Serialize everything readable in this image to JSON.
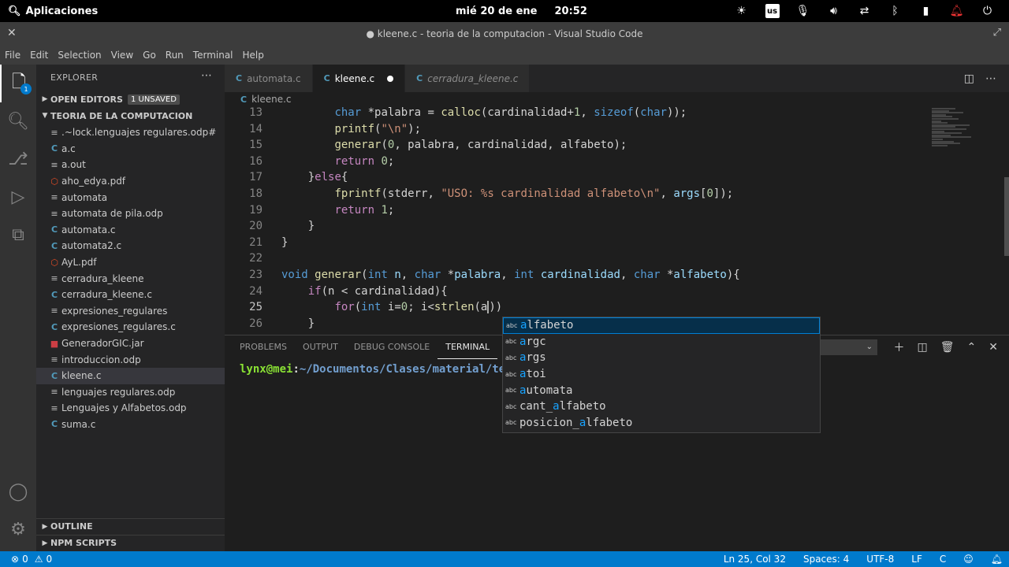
{
  "gnome": {
    "apps_label": "Aplicaciones",
    "date": "mié 20 de ene",
    "time": "20:52",
    "keyboard_layout": "us"
  },
  "window": {
    "title": "● kleene.c - teoria de la computacion - Visual Studio Code"
  },
  "menu": [
    "File",
    "Edit",
    "Selection",
    "View",
    "Go",
    "Run",
    "Terminal",
    "Help"
  ],
  "activity": {
    "explorer_badge": "1"
  },
  "sidebar": {
    "header": "EXPLORER",
    "open_editors": "OPEN EDITORS",
    "unsaved": "1 UNSAVED",
    "folder": "TEORIA DE LA COMPUTACION",
    "files": [
      {
        "name": ".~lock.lenguajes regulares.odp#",
        "type": "plain"
      },
      {
        "name": "a.c",
        "type": "c"
      },
      {
        "name": "a.out",
        "type": "plain"
      },
      {
        "name": "aho_edya.pdf",
        "type": "pdf"
      },
      {
        "name": "automata",
        "type": "plain"
      },
      {
        "name": "automata de pila.odp",
        "type": "plain"
      },
      {
        "name": "automata.c",
        "type": "c"
      },
      {
        "name": "automata2.c",
        "type": "c"
      },
      {
        "name": "AyL.pdf",
        "type": "pdf"
      },
      {
        "name": "cerradura_kleene",
        "type": "plain"
      },
      {
        "name": "cerradura_kleene.c",
        "type": "c"
      },
      {
        "name": "expresiones_regulares",
        "type": "plain"
      },
      {
        "name": "expresiones_regulares.c",
        "type": "c"
      },
      {
        "name": "GeneradorGIC.jar",
        "type": "jar"
      },
      {
        "name": "introduccion.odp",
        "type": "plain"
      },
      {
        "name": "kleene.c",
        "type": "c",
        "selected": true
      },
      {
        "name": "lenguajes regulares.odp",
        "type": "plain"
      },
      {
        "name": "Lenguajes y Alfabetos.odp",
        "type": "plain"
      },
      {
        "name": "suma.c",
        "type": "c"
      }
    ],
    "outline": "OUTLINE",
    "npm": "NPM SCRIPTS"
  },
  "tabs": [
    {
      "label": "automata.c",
      "active": false,
      "italic": false
    },
    {
      "label": "kleene.c",
      "active": true,
      "italic": false,
      "dirty": true
    },
    {
      "label": "cerradura_kleene.c",
      "active": false,
      "italic": true
    }
  ],
  "breadcrumb": "kleene.c",
  "code_lines": [
    {
      "n": "13",
      "html": "        <span class=\"kw\">char</span> *palabra = <span class=\"fn\">calloc</span>(cardinalidad+<span class=\"num\">1</span>, <span class=\"kw\">sizeof</span>(<span class=\"kw\">char</span>));"
    },
    {
      "n": "14",
      "html": "        <span class=\"fn\">printf</span>(<span class=\"str\">\"\\n\"</span>);"
    },
    {
      "n": "15",
      "html": "        <span class=\"fn\">generar</span>(<span class=\"num\">0</span>, palabra, cardinalidad, alfabeto);"
    },
    {
      "n": "16",
      "html": "        <span class=\"ctl\">return</span> <span class=\"num\">0</span>;"
    },
    {
      "n": "17",
      "html": "    }<span class=\"ctl\">else</span>{"
    },
    {
      "n": "18",
      "html": "        <span class=\"fn\">fprintf</span>(stderr, <span class=\"str\">\"USO: %s cardinalidad alfabeto\\n\"</span>, <span class=\"var\">args</span>[<span class=\"num\">0</span>]);"
    },
    {
      "n": "19",
      "html": "        <span class=\"ctl\">return</span> <span class=\"num\">1</span>;"
    },
    {
      "n": "20",
      "html": "    }"
    },
    {
      "n": "21",
      "html": "}"
    },
    {
      "n": "22",
      "html": ""
    },
    {
      "n": "23",
      "html": "<span class=\"kw\">void</span> <span class=\"fn\">generar</span>(<span class=\"kw\">int</span> <span class=\"var\">n</span>, <span class=\"kw\">char</span> *<span class=\"var\">palabra</span>, <span class=\"kw\">int</span> <span class=\"var\">cardinalidad</span>, <span class=\"kw\">char</span> *<span class=\"var\">alfabeto</span>){"
    },
    {
      "n": "24",
      "html": "    <span class=\"ctl\">if</span>(n < cardinalidad){"
    },
    {
      "n": "25",
      "html": "        <span class=\"ctl\">for</span>(<span class=\"kw\">int</span> i=<span class=\"num\">0</span>; i<<span class=\"fn\">strlen</span>(a<span class=\"cursor\"></span>))",
      "current": true
    },
    {
      "n": "26",
      "html": "    }"
    }
  ],
  "panel": {
    "tabs": [
      "PROBLEMS",
      "OUTPUT",
      "DEBUG CONSOLE",
      "TERMINAL"
    ],
    "active": "TERMINAL",
    "terminal_user": "lynx@mei",
    "terminal_colon": ":",
    "terminal_path": "~/Documentos/Clases/material/te"
  },
  "suggest": [
    {
      "pre": "",
      "hl": "a",
      "post": "lfabeto",
      "selected": true
    },
    {
      "pre": "",
      "hl": "a",
      "post": "rgc"
    },
    {
      "pre": "",
      "hl": "a",
      "post": "rgs"
    },
    {
      "pre": "",
      "hl": "a",
      "post": "toi"
    },
    {
      "pre": "",
      "hl": "a",
      "post": "utomata"
    },
    {
      "pre": "cant_",
      "hl": "a",
      "post": "lfabeto"
    },
    {
      "pre": "posicion_",
      "hl": "a",
      "post": "lfabeto"
    }
  ],
  "suggest_kind": "abc",
  "status": {
    "errors": "0",
    "warnings": "0",
    "position": "Ln 25, Col 32",
    "spaces": "Spaces: 4",
    "encoding": "UTF-8",
    "eol": "LF",
    "language": "C"
  }
}
